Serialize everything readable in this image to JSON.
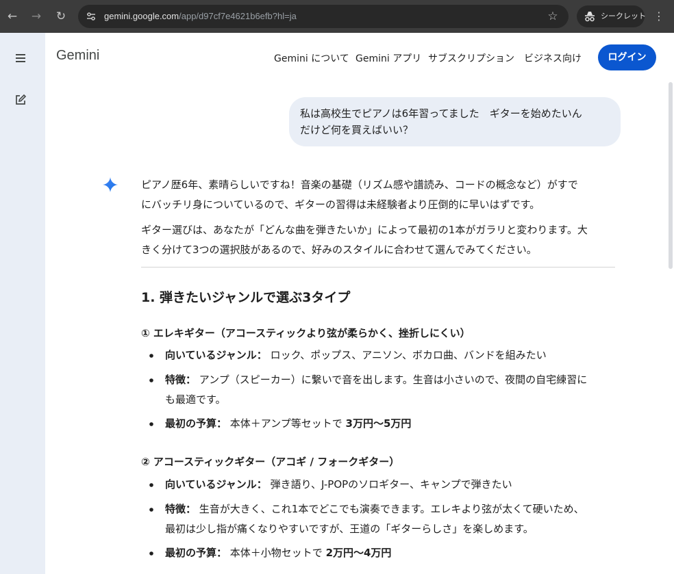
{
  "browser": {
    "url_host": "gemini.google.com",
    "url_path": "/app/d97cf7e4621b6efb?hl=ja",
    "incognito_label": "シークレット",
    "icons": [
      "back-icon",
      "forward-icon",
      "reload-icon",
      "site-info-icon",
      "bookmark-star-icon",
      "incognito-icon",
      "more-menu-icon"
    ]
  },
  "header": {
    "logo": "Gemini",
    "nav": [
      "Gemini について",
      "Gemini アプリ",
      "サブスクリプション",
      "ビジネス向け"
    ],
    "login_label": "ログイン"
  },
  "sidebar": {
    "icons": [
      "menu-icon",
      "new-chat-icon"
    ]
  },
  "chat": {
    "user_message_line1": "私は高校生でピアノは6年習ってました　ギターを始めたいん",
    "user_message_line2": "だけど何を買えばいい？",
    "response": {
      "p1_line1": "ピアノ歴6年、素晴らしいですね！音楽の基礎（リズム感や譜読み、コードの概念など）がすで",
      "p1_line2": "にバッチリ身についているので、ギターの習得は未経験者より圧倒的に早いはずです。",
      "p2_line1": "ギター選びは、あなたが「どんな曲を弾きたいか」によって最初の1本がガラリと変わります。大",
      "p2_line2": "きく分けて3つの選択肢があるので、好みのスタイルに合わせて選んでみてください。",
      "heading": "1. 弾きたいジャンルで選ぶ3タイプ",
      "sections": [
        {
          "title": "① エレキギター（アコースティックより弦が柔らかく、挫折しにくい）",
          "items": [
            {
              "label": "向いているジャンル：",
              "text": " ロック、ポップス、アニソン、ボカロ曲、バンドを組みたい"
            },
            {
              "label": "特徴：",
              "text": " アンプ（スピーカー）に繋いで音を出します。生音は小さいので、夜間の自宅練習に",
              "text2": "も最適です。"
            },
            {
              "label": "最初の予算：",
              "text": " 本体＋アンプ等セットで ",
              "bold": "3万円〜5万円"
            }
          ]
        },
        {
          "title": "② アコースティックギター（アコギ / フォークギター）",
          "items": [
            {
              "label": "向いているジャンル：",
              "text": " 弾き語り、J-POPのソロギター、キャンプで弾きたい"
            },
            {
              "label": "特徴：",
              "text": " 生音が大きく、これ1本でどこでも演奏できます。エレキより弦が太くて硬いため、",
              "text2": "最初は少し指が痛くなりやすいですが、王道の「ギターらしさ」を楽しめます。"
            },
            {
              "label": "最初の予算：",
              "text": " 本体＋小物セットで ",
              "bold": "2万円〜4万円"
            }
          ]
        }
      ]
    }
  }
}
